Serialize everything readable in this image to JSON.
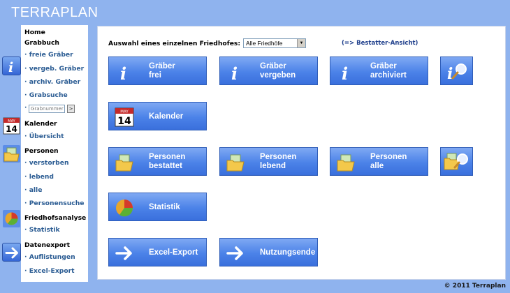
{
  "app": {
    "logo": "TERRAPLAN"
  },
  "sidebar": {
    "home": "Home",
    "grabbuch": {
      "title": "Grabbuch",
      "items": [
        "freie Gräber",
        "vergeb. Gräber",
        "archiv. Gräber",
        "Grabsuche"
      ],
      "search_placeholder": "Grabnummer",
      "search_button": ">"
    },
    "kalender": {
      "title": "Kalender",
      "items": [
        "Übersicht"
      ]
    },
    "personen": {
      "title": "Personen",
      "items": [
        "verstorben",
        "lebend",
        "alle",
        "Personensuche"
      ]
    },
    "friedhofsanalyse": {
      "title": "Friedhofsanalyse",
      "items": [
        "Statistik"
      ]
    },
    "datenexport": {
      "title": "Datenexport",
      "items": [
        "Auflistungen",
        "Excel-Export"
      ]
    },
    "bullet": "·",
    "calendar_icon": {
      "month": "MAY",
      "day": "14"
    }
  },
  "main": {
    "select_label": "Auswahl eines einzelnen Friedhofes:",
    "select_value": "Alle Friedhöfe",
    "bestatter_link": "(=> Bestatter-Ansicht)",
    "tiles": {
      "graeber_frei": [
        "Gräber",
        "frei"
      ],
      "graeber_vergeben": [
        "Gräber",
        "vergeben"
      ],
      "graeber_archiviert": [
        "Gräber",
        "archiviert"
      ],
      "kalender": "Kalender",
      "personen_bestattet": [
        "Personen",
        "bestattet"
      ],
      "personen_lebend": [
        "Personen",
        "lebend"
      ],
      "personen_alle": [
        "Personen",
        "alle"
      ],
      "statistik": "Statistik",
      "excel_export": "Excel-Export",
      "nutzungsende": "Nutzungsende"
    },
    "icon_letter": "i",
    "calendar_icon": {
      "month": "MAY",
      "day": "14"
    }
  },
  "footer": {
    "copyright": "© 2011 Terraplan"
  },
  "colors": {
    "background": "#8fb3ee",
    "tile_gradient_top": "#7fa9f3",
    "tile_gradient_bottom": "#3a6fdc",
    "link": "#2b5c93"
  }
}
